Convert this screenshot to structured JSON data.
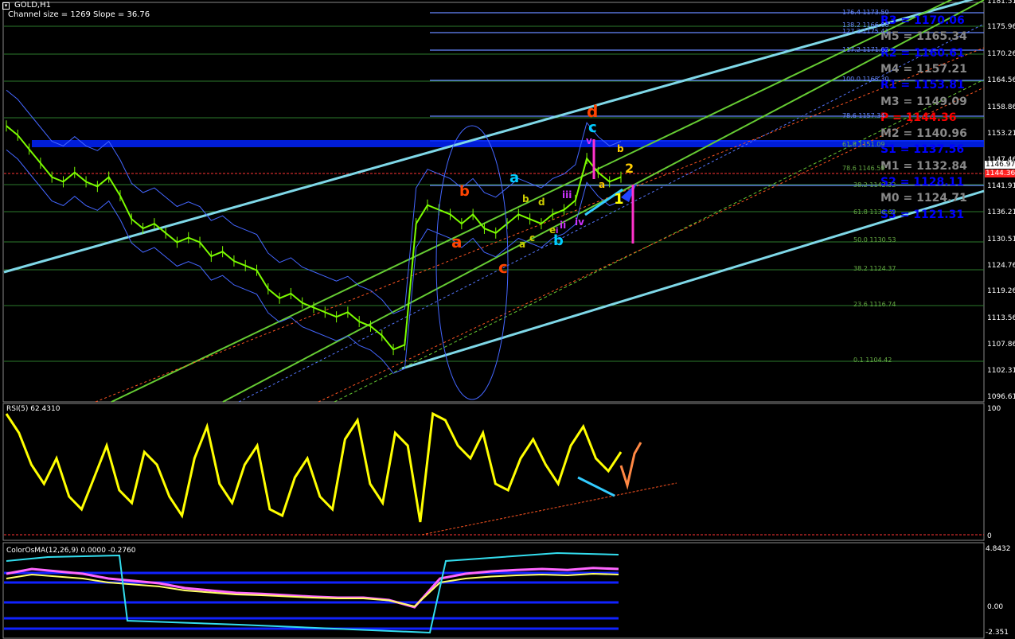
{
  "window": {
    "title": "GOLD,H1",
    "channel_info": "Channel size = 1269 Slope = 36.76",
    "menu_icon": "window-menu-icon"
  },
  "colors": {
    "background": "#000000",
    "candles": "#7CFC00",
    "axis": "#ffffff",
    "grid_level": "#2b7a2b",
    "cyan_channel": "#7fd8e8",
    "green_channel": "#66cc33",
    "blue_band": "#0022ff",
    "rsi_line": "#ffff00",
    "macd_line": "#ff66ff",
    "current_price_bg": "#ff2222"
  },
  "price_axis": {
    "ticks": [
      "1181.51",
      "1175.96",
      "1170.26",
      "1164.56",
      "1158.86",
      "1153.21",
      "1147.46",
      "1141.91",
      "1136.21",
      "1130.51",
      "1124.76",
      "1119.26",
      "1113.56",
      "1107.86",
      "1102.31",
      "1096.61"
    ],
    "current_price": "1146.97",
    "current_price_red": "1144.36"
  },
  "fibo_levels": [
    {
      "label": "176.4",
      "value": "1173.50"
    },
    {
      "label": "138.2",
      "value": "1166.60"
    },
    {
      "label": "127.2",
      "value": "1175.41"
    },
    {
      "label": "117.2",
      "value": "1171.62"
    },
    {
      "label": "100.0",
      "value": "1165.30"
    },
    {
      "label": "78.6",
      "value": "1157.34"
    },
    {
      "label": "61.8",
      "value": "1151.09"
    },
    {
      "label": "78.6",
      "value": "1146.59"
    },
    {
      "label": "38.2",
      "value": "1142.32"
    },
    {
      "label": "61.8",
      "value": "1136.69"
    },
    {
      "label": "50.0",
      "value": "1130.53"
    },
    {
      "label": "38.2",
      "value": "1124.37"
    },
    {
      "label": "23.6",
      "value": "1116.74"
    },
    {
      "label": "0.1",
      "value": "1104.42"
    }
  ],
  "pivot_levels": [
    {
      "name": "R3",
      "value": "1170.06",
      "color": "#0000ff"
    },
    {
      "name": "M5",
      "value": "1165.34",
      "color": "#888888"
    },
    {
      "name": "R2",
      "value": "1160.61",
      "color": "#0000ff"
    },
    {
      "name": "M4",
      "value": "1157.21",
      "color": "#888888"
    },
    {
      "name": "R1",
      "value": "1153.81",
      "color": "#0000ff"
    },
    {
      "name": "M3",
      "value": "1149.09",
      "color": "#888888"
    },
    {
      "name": "P",
      "value": "1144.36",
      "color": "#ff0000"
    },
    {
      "name": "M2",
      "value": "1140.96",
      "color": "#888888"
    },
    {
      "name": "S1",
      "value": "1137.56",
      "color": "#0000ff"
    },
    {
      "name": "M1",
      "value": "1132.84",
      "color": "#888888"
    },
    {
      "name": "S2",
      "value": "1128.11",
      "color": "#0000ff"
    },
    {
      "name": "M0",
      "value": "1124.71",
      "color": "#888888"
    },
    {
      "name": "S3",
      "value": "1121.31",
      "color": "#0000ff"
    }
  ],
  "wave_labels": [
    {
      "text": "d",
      "color": "#ff4400"
    },
    {
      "text": "c",
      "color": "#00ccff"
    },
    {
      "text": "v",
      "color": "#cc33ff"
    },
    {
      "text": "b",
      "color": "#ffcc00"
    },
    {
      "text": "2",
      "color": "#ffcc00"
    },
    {
      "text": "1",
      "color": "#ffff00"
    },
    {
      "text": "a",
      "color": "#00ccff"
    },
    {
      "text": "b",
      "color": "#ff4400"
    },
    {
      "text": "a",
      "color": "#ff4400"
    },
    {
      "text": "c",
      "color": "#ff4400"
    },
    {
      "text": "b",
      "color": "#00ccff"
    },
    {
      "text": "iii",
      "color": "#cc33ff"
    },
    {
      "text": "iv",
      "color": "#cc33ff"
    },
    {
      "text": "ii",
      "color": "#cc33ff"
    },
    {
      "text": "i",
      "color": "#cc33ff"
    },
    {
      "text": "b",
      "color": "#cccc00"
    },
    {
      "text": "d",
      "color": "#cccc00"
    },
    {
      "text": "e",
      "color": "#cccc00"
    },
    {
      "text": "c",
      "color": "#cccc00"
    },
    {
      "text": "a",
      "color": "#cccc00"
    },
    {
      "text": "a",
      "color": "#ffcc00"
    }
  ],
  "rsi_panel": {
    "title": "RSI(5) 62.4310",
    "ticks": [
      "100",
      "0"
    ]
  },
  "macd_panel": {
    "title": "ColorOsMA(12,26,9) 0.0000 -0.2760",
    "ticks": [
      "4.8432",
      "0.00",
      "-2.351"
    ]
  },
  "chart_data": {
    "type": "line",
    "title": "GOLD,H1",
    "series": [
      {
        "name": "GOLD,H1",
        "values": [
          1155,
          1153,
          1150,
          1147,
          1144,
          1143,
          1145,
          1143,
          1142,
          1144,
          1140,
          1135,
          1133,
          1134,
          1132,
          1130,
          1131,
          1130,
          1127,
          1128,
          1126,
          1125,
          1124,
          1120,
          1118,
          1119,
          1117,
          1116,
          1115,
          1114,
          1115,
          1113,
          1112,
          1110,
          1107,
          1108,
          1134,
          1138,
          1137,
          1136,
          1134,
          1136,
          1133,
          1132,
          1134,
          1136,
          1135,
          1134,
          1136,
          1137,
          1139,
          1148,
          1145,
          1143,
          1144
        ]
      }
    ],
    "ylim": [
      1096.61,
      1181.51
    ]
  }
}
